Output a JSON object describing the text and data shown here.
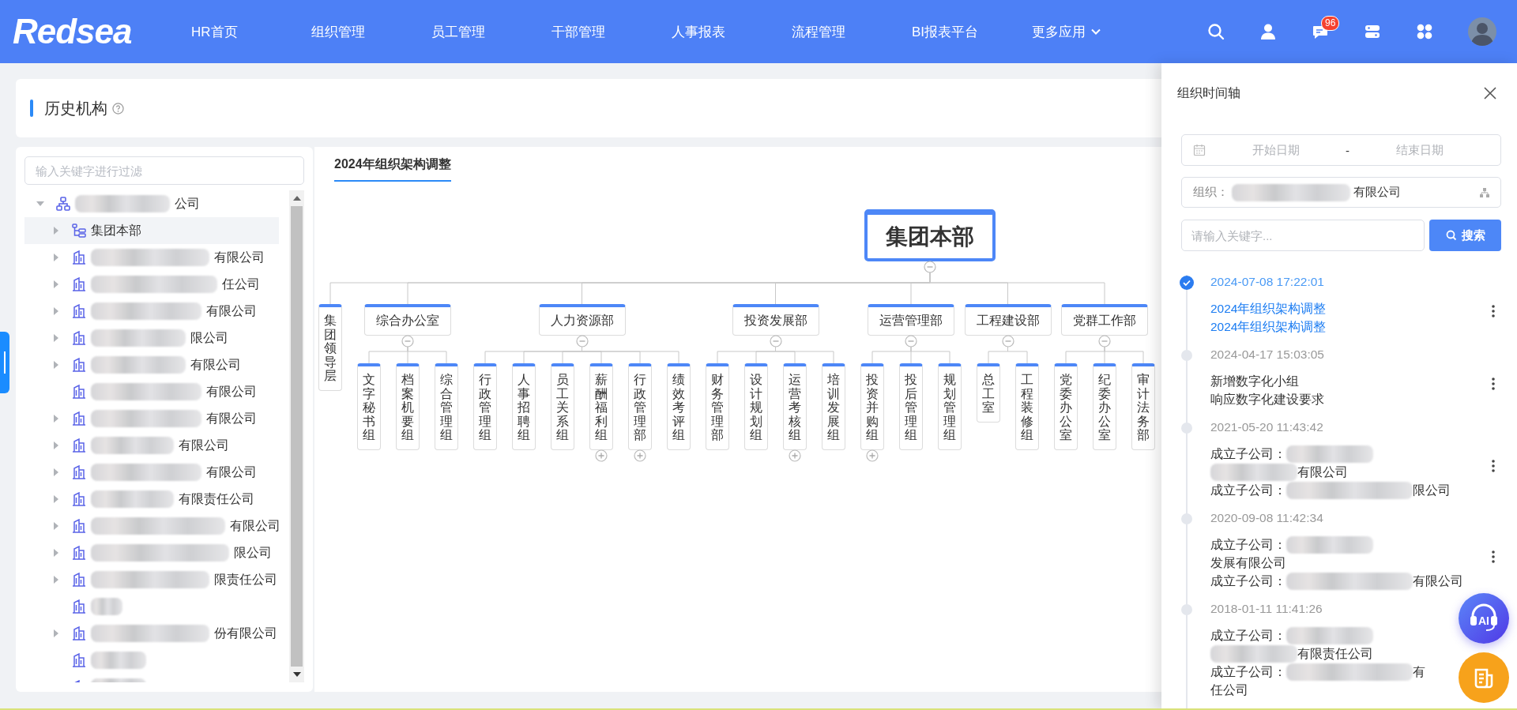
{
  "header": {
    "logo": "Redsea",
    "nav": [
      {
        "label": "HR首页",
        "dropdown": false
      },
      {
        "label": "组织管理",
        "dropdown": false
      },
      {
        "label": "员工管理",
        "dropdown": false
      },
      {
        "label": "干部管理",
        "dropdown": false
      },
      {
        "label": "人事报表",
        "dropdown": false
      },
      {
        "label": "流程管理",
        "dropdown": false
      },
      {
        "label": "BI报表平台",
        "dropdown": false
      },
      {
        "label": "更多应用",
        "dropdown": true
      }
    ],
    "notification_count": "96"
  },
  "page_title": "历史机构",
  "tree": {
    "filter_placeholder": "输入关键字进行过滤",
    "root": {
      "label": "公司",
      "masked": true,
      "kind": "org",
      "expanded": true,
      "selected": false,
      "children": [
        {
          "label": "集团本部",
          "kind": "department",
          "expanded": false,
          "selected": true
        },
        {
          "label": "有限公司",
          "kind": "company",
          "masked": true,
          "expanded": false,
          "selected": false
        },
        {
          "label": "任公司",
          "kind": "company",
          "masked": true,
          "expanded": false,
          "selected": false
        },
        {
          "label": "有限公司",
          "kind": "company",
          "masked": true,
          "expanded": false,
          "selected": false
        },
        {
          "label": "限公司",
          "kind": "company",
          "masked": true,
          "expanded": false,
          "selected": false
        },
        {
          "label": "有限公司",
          "kind": "company",
          "masked": true,
          "expanded": false,
          "selected": false
        },
        {
          "label": "有限公司",
          "kind": "company",
          "masked": true,
          "selected": false
        },
        {
          "label": "有限公司",
          "kind": "company",
          "masked": true,
          "expanded": false,
          "selected": false
        },
        {
          "label": "有限公司",
          "kind": "company",
          "masked": true,
          "expanded": false,
          "selected": false
        },
        {
          "label": "有限公司",
          "kind": "company",
          "masked": true,
          "expanded": false,
          "selected": false
        },
        {
          "label": "有限责任公司",
          "kind": "company",
          "masked": true,
          "expanded": false,
          "selected": false
        },
        {
          "label": "有限公司",
          "kind": "company",
          "masked": true,
          "expanded": false,
          "selected": false
        },
        {
          "label": "限公司",
          "kind": "company",
          "masked": true,
          "expanded": false,
          "selected": false
        },
        {
          "label": "限责任公司",
          "kind": "company",
          "masked": true,
          "expanded": false,
          "selected": false
        },
        {
          "kind": "company",
          "masked": true,
          "selected": false
        },
        {
          "label": "份有限公司",
          "kind": "company",
          "masked": true,
          "expanded": false,
          "selected": false
        },
        {
          "kind": "company",
          "masked": true,
          "selected": false
        },
        {
          "kind": "company",
          "masked": true,
          "selected": false
        }
      ]
    }
  },
  "chart_tab": {
    "label": "2024年组织架构调整",
    "selected": true
  },
  "org_chart": {
    "name": "集团本部",
    "expanded": true,
    "children": [
      {
        "name": "集团领导层",
        "kind": "vertical"
      },
      {
        "name": "综合办公室",
        "kind": "horizontal",
        "expanded": true,
        "children": [
          {
            "name": "文字秘书组"
          },
          {
            "name": "档案机要组"
          },
          {
            "name": "综合管理组"
          }
        ]
      },
      {
        "name": "人力资源部",
        "kind": "horizontal",
        "expanded": true,
        "children": [
          {
            "name": "行政管理组"
          },
          {
            "name": "人事招聘组"
          },
          {
            "name": "员工关系组"
          },
          {
            "name": "薪酬福利组",
            "expanded": false
          },
          {
            "name": "行政管理部",
            "expanded": false
          },
          {
            "name": "绩效考评组"
          }
        ]
      },
      {
        "name": "投资发展部",
        "kind": "horizontal",
        "expanded": true,
        "children": [
          {
            "name": "财务管理部"
          },
          {
            "name": "设计规划组"
          },
          {
            "name": "运营考核组",
            "expanded": false
          },
          {
            "name": "培训发展组"
          }
        ]
      },
      {
        "name": "运营管理部",
        "kind": "horizontal",
        "expanded": true,
        "children": [
          {
            "name": "投资并购组",
            "expanded": false
          },
          {
            "name": "投后管理组"
          },
          {
            "name": "规划管理组"
          }
        ]
      },
      {
        "name": "工程建设部",
        "kind": "horizontal",
        "expanded": true,
        "children": [
          {
            "name": "总工室"
          },
          {
            "name": "工程装修组"
          }
        ]
      },
      {
        "name": "党群工作部",
        "kind": "horizontal",
        "expanded": true,
        "children": [
          {
            "name": "党委办公室"
          },
          {
            "name": "纪委办公室"
          },
          {
            "name": "审计法务部"
          }
        ]
      }
    ]
  },
  "timeline_panel": {
    "title": "组织时间轴",
    "date_range": {
      "start_placeholder": "开始日期",
      "separator": "-",
      "end_placeholder": "结束日期"
    },
    "org_field": {
      "label": "组织：",
      "masked": true,
      "value": "有限公司"
    },
    "keyword_field": {
      "placeholder": "请输入关键字..."
    },
    "search_button": "搜索",
    "entries": [
      {
        "time": "2024-07-08 17:22:01",
        "selected": true,
        "menu": true,
        "lines": [
          {
            "text": "2024年组织架构调整"
          },
          {
            "text": "2024年组织架构调整"
          }
        ]
      },
      {
        "time": "2024-04-17 15:03:05",
        "selected": false,
        "menu": true,
        "lines": [
          {
            "text": "新增数字化小组"
          },
          {
            "text": "响应数字化建设要求"
          }
        ]
      },
      {
        "time": "2021-05-20 11:43:42",
        "selected": false,
        "menu": true,
        "lines": [
          {
            "label": "成立子公司：",
            "masked": true
          },
          {
            "masked": true,
            "text": "有限公司"
          },
          {
            "label": "成立子公司：",
            "masked": true,
            "text": "限公司"
          }
        ]
      },
      {
        "time": "2020-09-08 11:42:34",
        "selected": false,
        "menu": true,
        "lines": [
          {
            "label": "成立子公司：",
            "masked": true
          },
          {
            "text": "发展有限公司"
          },
          {
            "label": "成立子公司：",
            "masked": true,
            "text": "有限公司"
          }
        ]
      },
      {
        "time": "2018-01-11 11:41:26",
        "selected": false,
        "menu": false,
        "lines": [
          {
            "label": "成立子公司：",
            "masked": true
          },
          {
            "masked": true,
            "text": "有限责任公司"
          },
          {
            "label": "成立子公司：",
            "masked": true,
            "text": "有"
          },
          {
            "text": "任公司"
          }
        ]
      }
    ]
  },
  "assistant_label": "AI"
}
